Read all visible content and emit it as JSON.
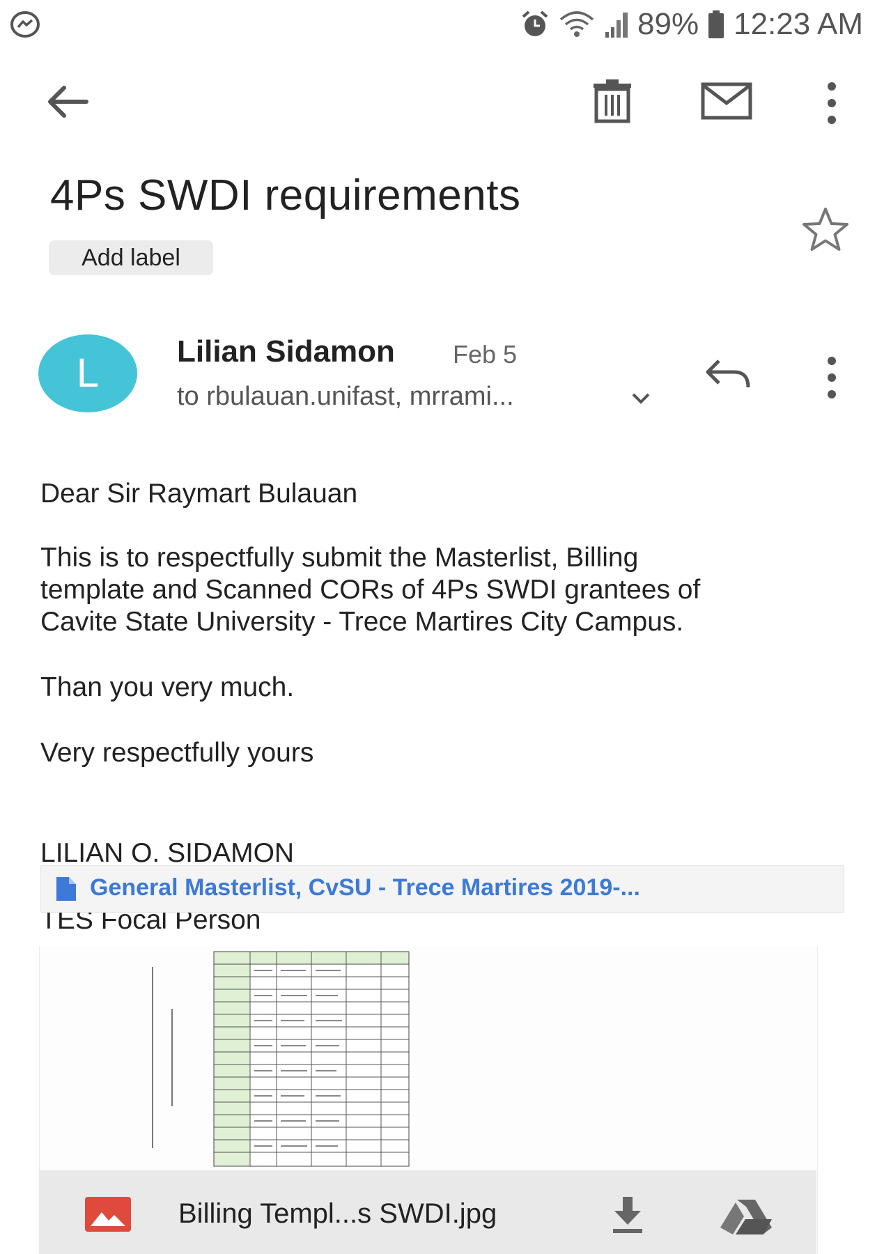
{
  "status_bar": {
    "battery": "89%",
    "time": "12:23 AM",
    "icons": [
      "messenger-icon",
      "alarm-icon",
      "wifi-icon",
      "signal-icon",
      "battery-icon"
    ]
  },
  "toolbar": {
    "icons": [
      "back-arrow-icon",
      "trash-icon",
      "mail-icon",
      "more-vert-icon"
    ]
  },
  "email": {
    "subject": "4Ps SWDI requirements",
    "add_label": "Add label",
    "sender": {
      "initial": "L",
      "name": "Lilian Sidamon",
      "date": "Feb 5",
      "recipients": "to rbulauan.unifast, mrrami..."
    },
    "body": {
      "greeting": "Dear Sir Raymart Bulauan",
      "paragraph": "This is to respectfully submit the Masterlist, Billing\ntemplate and Scanned CORs of 4Ps SWDI grantees of\nCavite State University - Trece Martires City Campus.",
      "thanks": "Than you very much.",
      "closing": "Very respectfully yours",
      "signature_name": "LILIAN O. SIDAMON",
      "signature_title": "TES Focal Person"
    },
    "attachments": {
      "link_text": "General Masterlist, CvSU - Trece Martires 2019-...",
      "image_name": "Billing Templ...s SWDI.jpg"
    }
  },
  "colors": {
    "avatar": "#45c4d8",
    "link": "#3d79d6",
    "image_icon": "#e04a3c"
  }
}
